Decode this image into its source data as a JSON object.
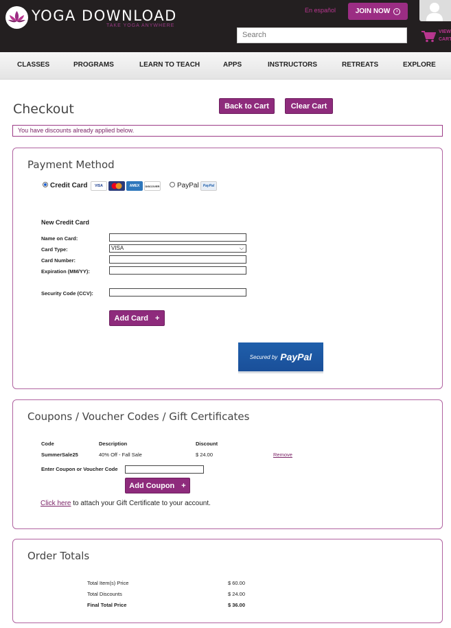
{
  "header": {
    "logo_text": "YOGA DOWNLOAD",
    "tagline": "TAKE YOGA ANYWHERE",
    "language_link": "En español",
    "join_label": "JOIN NOW",
    "search_placeholder": "Search",
    "cart_line1": "VIEW",
    "cart_line2": "CART",
    "accent_color": "#9b2d83"
  },
  "nav": {
    "items": [
      "CLASSES",
      "PROGRAMS",
      "LEARN TO TEACH",
      "APPS",
      "INSTRUCTORS",
      "RETREATS",
      "EXPLORE"
    ]
  },
  "page": {
    "title": "Checkout",
    "back_to_cart": "Back to Cart",
    "clear_cart": "Clear Cart",
    "notice": "You have discounts already applied below."
  },
  "payment": {
    "title": "Payment Method",
    "option_credit": "Credit Card",
    "option_paypal": "PayPal",
    "card_icons": [
      "VISA",
      "MC",
      "AMEX",
      "DISCOVER"
    ],
    "paypal_small_logo": "PayPal",
    "new_card_heading": "New Credit Card",
    "name_label": "Name on Card:",
    "type_label": "Card Type:",
    "type_value": "VISA",
    "number_label": "Card Number:",
    "expiry_label": "Expiration (MM/YY):",
    "ccv_label": "Security Code (CCV):",
    "add_card": "Add Card",
    "secured_by": "Secured by",
    "paypal_brand": "PayPal"
  },
  "coupons": {
    "title": "Coupons / Voucher Codes / Gift Certificates",
    "columns": [
      "Code",
      "Description",
      "Discount"
    ],
    "rows": [
      {
        "code": "SummerSale25",
        "description": "40% Off - Fall Sale",
        "discount": "$ 24.00",
        "action": "Remove"
      }
    ],
    "enter_label": "Enter Coupon or Voucher Code",
    "add_coupon": "Add Coupon",
    "click_here": "Click here",
    "gift_text": " to attach your Gift Certificate to your account."
  },
  "totals": {
    "title": "Order Totals",
    "items_label": "Total Item(s) Price",
    "items_value": "$ 60.00",
    "discounts_label": "Total Discounts",
    "discounts_value": "$ 24.00",
    "final_label": "Final Total Price",
    "final_value": "$ 36.00"
  }
}
